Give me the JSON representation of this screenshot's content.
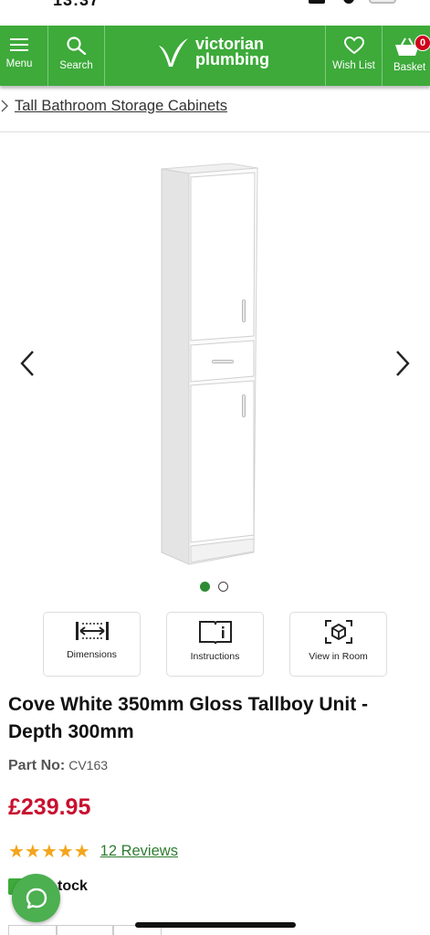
{
  "status_bar": {
    "time": "13:37"
  },
  "nav": {
    "menu_label": "Menu",
    "search_label": "Search",
    "logo_line1": "victorian",
    "logo_line2": "plumbing",
    "wishlist_label": "Wish List",
    "basket_label": "Basket",
    "basket_count": "0",
    "brand_color": "#3daa3a"
  },
  "breadcrumb": {
    "link": "Tall Bathroom Storage Cabinets"
  },
  "gallery": {
    "image_count": 2,
    "active_index": 0,
    "image_alt": "white-tallboy-cabinet"
  },
  "features": [
    {
      "label": "Dimensions",
      "icon": "dimensions-icon"
    },
    {
      "label": "Instructions",
      "icon": "instructions-icon"
    },
    {
      "label": "View in Room",
      "icon": "ar-cube-icon"
    }
  ],
  "product": {
    "title": "Cove White 350mm Gloss Tallboy Unit - Depth 300mm",
    "part_no_label": "Part No:",
    "part_no": "CV163",
    "price": "£239.95",
    "price_color": "#c8102e",
    "rating_stars": "★★★★★",
    "rating_value": 5,
    "reviews_link": "12 Reviews",
    "stock_text": "tock"
  }
}
